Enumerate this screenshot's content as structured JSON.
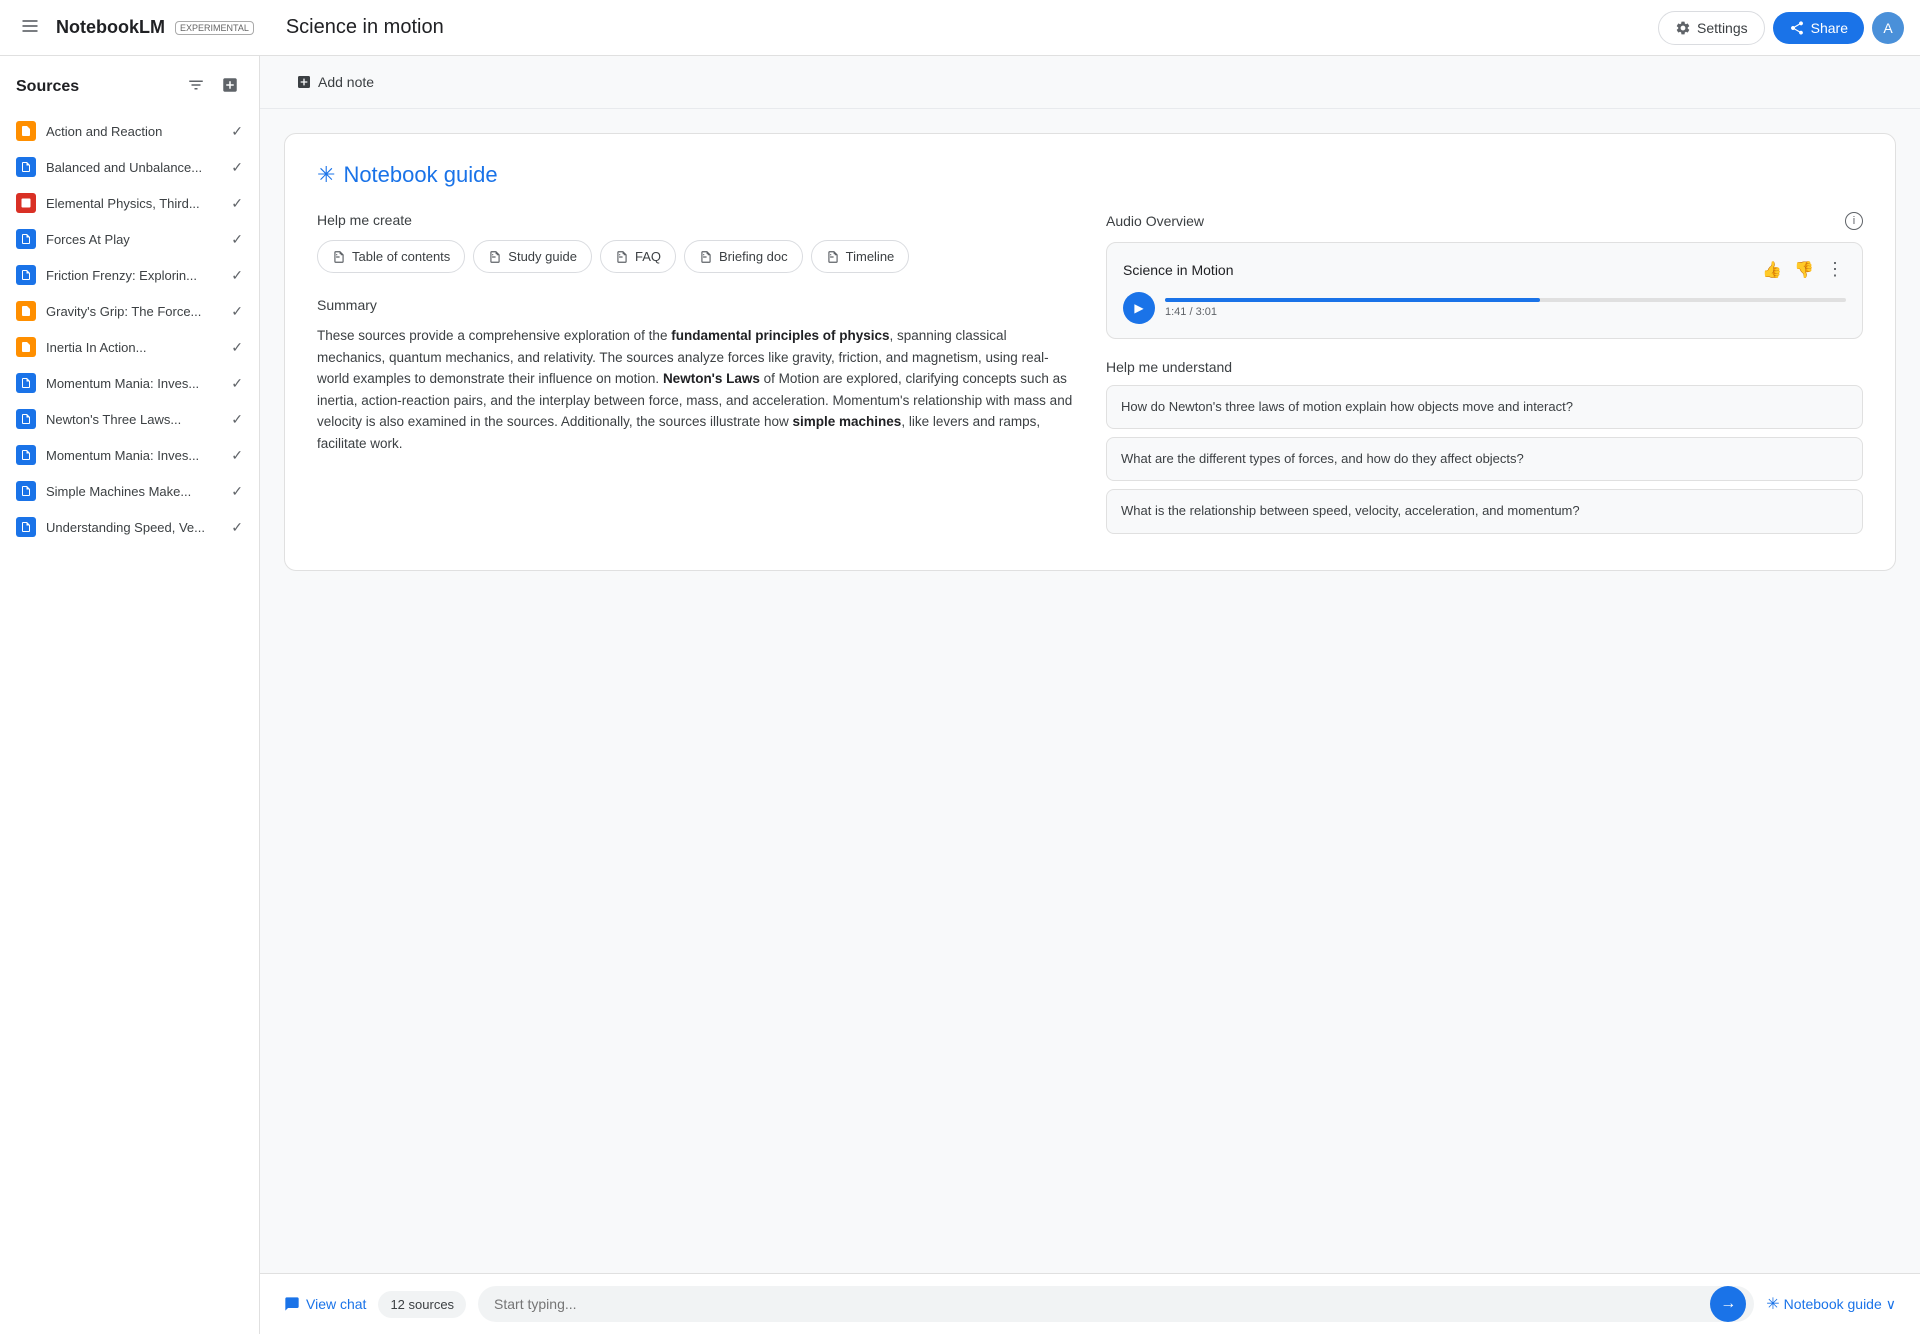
{
  "topbar": {
    "menu_icon": "☰",
    "app_name": "NotebookLM",
    "experimental_badge": "EXPERIMENTAL",
    "notebook_title": "Science in motion",
    "settings_label": "Settings",
    "share_label": "Share",
    "avatar_initials": "A"
  },
  "sidebar": {
    "title": "Sources",
    "filter_icon": "≡",
    "add_icon": "+",
    "sources": [
      {
        "name": "Action and Reaction",
        "icon_type": "orange",
        "icon_char": "▬",
        "checked": true
      },
      {
        "name": "Balanced and Unbalance...",
        "icon_type": "blue",
        "icon_char": "≡",
        "checked": true
      },
      {
        "name": "Elemental Physics, Third...",
        "icon_type": "red",
        "icon_char": "▣",
        "checked": true
      },
      {
        "name": "Forces At Play",
        "icon_type": "blue",
        "icon_char": "≡",
        "checked": true
      },
      {
        "name": "Friction Frenzy: Explorin...",
        "icon_type": "blue",
        "icon_char": "≡",
        "checked": true
      },
      {
        "name": "Gravity's Grip: The Force...",
        "icon_type": "orange",
        "icon_char": "▬",
        "checked": true
      },
      {
        "name": "Inertia In Action...",
        "icon_type": "orange",
        "icon_char": "▬",
        "checked": true
      },
      {
        "name": "Momentum Mania: Inves...",
        "icon_type": "blue",
        "icon_char": "≡",
        "checked": true
      },
      {
        "name": "Newton's Three Laws...",
        "icon_type": "blue",
        "icon_char": "≡",
        "checked": true
      },
      {
        "name": "Momentum Mania: Inves...",
        "icon_type": "blue",
        "icon_char": "≡",
        "checked": true
      },
      {
        "name": "Simple Machines Make...",
        "icon_type": "blue",
        "icon_char": "≡",
        "checked": true
      },
      {
        "name": "Understanding Speed, Ve...",
        "icon_type": "blue",
        "icon_char": "≡",
        "checked": true
      }
    ]
  },
  "toolbar": {
    "add_note_label": "Add note"
  },
  "notebook_guide": {
    "asterisk": "✳",
    "title": "Notebook guide",
    "help_me_create_label": "Help me create",
    "actions": [
      {
        "id": "table_of_contents",
        "icon": "⊞",
        "label": "Table of contents"
      },
      {
        "id": "study_guide",
        "icon": "⊞",
        "label": "Study guide"
      },
      {
        "id": "faq",
        "icon": "⊞",
        "label": "FAQ"
      },
      {
        "id": "briefing_doc",
        "icon": "⊞",
        "label": "Briefing doc"
      },
      {
        "id": "timeline",
        "icon": "⊟",
        "label": "Timeline"
      }
    ],
    "summary_label": "Summary",
    "summary_text": "These sources provide a comprehensive exploration of the fundamental principles of physics, spanning classical mechanics, quantum mechanics, and relativity. The sources analyze forces like gravity, friction, and magnetism, using real-world examples to demonstrate their influence on motion. Newton's Laws of Motion are explored, clarifying concepts such as inertia, action-reaction pairs, and the interplay between force, mass, and acceleration. Momentum's relationship with mass and velocity is also examined in the sources. Additionally, the sources illustrate how simple machines, like levers and ramps, facilitate work.",
    "summary_bold_1": "fundamental principles of physics",
    "summary_bold_2": "Newton's Laws",
    "summary_bold_3": "simple machines",
    "audio_overview_label": "Audio Overview",
    "audio_title": "Science in Motion",
    "audio_time": "1:41 / 3:01",
    "audio_progress_pct": 55,
    "help_me_understand_label": "Help me understand",
    "understand_questions": [
      "How do Newton's three laws of motion explain how objects move and interact?",
      "What are the different types of forces, and how do they affect objects?",
      "What is the relationship between speed, velocity, acceleration, and momentum?"
    ]
  },
  "bottom_bar": {
    "view_chat_label": "View chat",
    "sources_count": "12 sources",
    "input_placeholder": "Start typing...",
    "send_icon": "→",
    "notebook_guide_label": "Notebook guide",
    "chevron_icon": "∨"
  }
}
